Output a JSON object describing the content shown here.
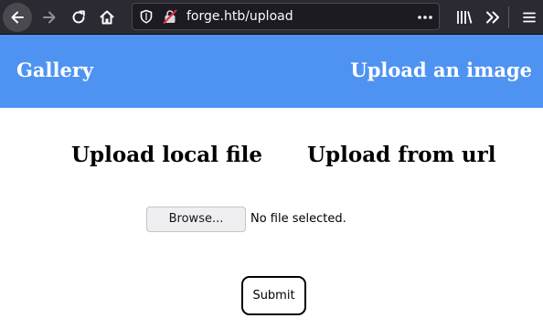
{
  "browser": {
    "toolbar_color": "#2b2a33",
    "icons": {
      "back": "back-arrow-icon",
      "forward": "forward-arrow-icon",
      "reload": "reload-icon",
      "home": "home-icon",
      "tracking_protection": "shield-icon",
      "connection": "insecure-lock-icon",
      "page_actions": "more-dots-icon",
      "library": "library-icon",
      "overflow": "double-chevron-icon",
      "menu": "hamburger-menu-icon"
    },
    "url": "forge.htb/upload"
  },
  "header": {
    "background": "#4f93f2",
    "brand_label": "Gallery",
    "upload_link_label": "Upload an image"
  },
  "main": {
    "tabs": [
      {
        "label": "Upload local file"
      },
      {
        "label": "Upload from url"
      }
    ],
    "file_input": {
      "button_label": "Browse...",
      "status_text": "No file selected."
    },
    "submit_label": "Submit"
  }
}
